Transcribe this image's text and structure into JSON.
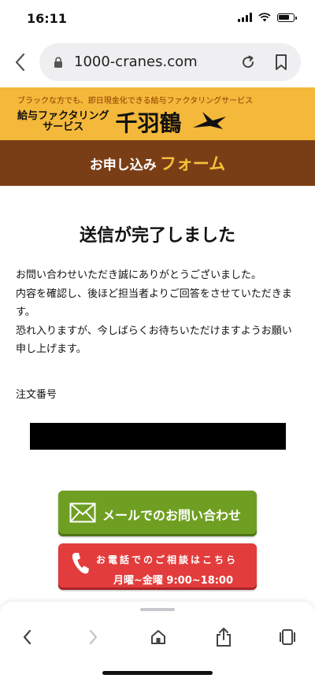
{
  "status_bar": {
    "time": "16:11"
  },
  "browser": {
    "url": "1000-cranes.com"
  },
  "site": {
    "tagline": "ブラックな方でも、即日現金化できる給与ファクタリングサービス",
    "brand_sub_line1": "給与ファクタリング",
    "brand_sub_line2": "サービス",
    "brand_name": "千羽鶴",
    "banner_prefix": "お申し込み",
    "banner_accent": "フォーム"
  },
  "content": {
    "title": "送信が完了しました",
    "message_lines": [
      "お問い合わせいただき誠にありがとうございました。",
      "内容を確認し、後ほど担当者よりご回答をさせていただきます。",
      "恐れ入りますが、今しばらくお待ちいただけますようお願い申し上げます。"
    ],
    "order_label": "注文番号"
  },
  "buttons": {
    "mail_label": "メールでのお問い合わせ",
    "phone_label": "お電話でのご相談はこちら",
    "phone_hours": "月曜~金曜 9:00~18:00"
  },
  "colors": {
    "header_bg": "#f4b83a",
    "banner_bg": "#7a3e16",
    "mail_button": "#6f9f22",
    "phone_button": "#e23c3c"
  }
}
